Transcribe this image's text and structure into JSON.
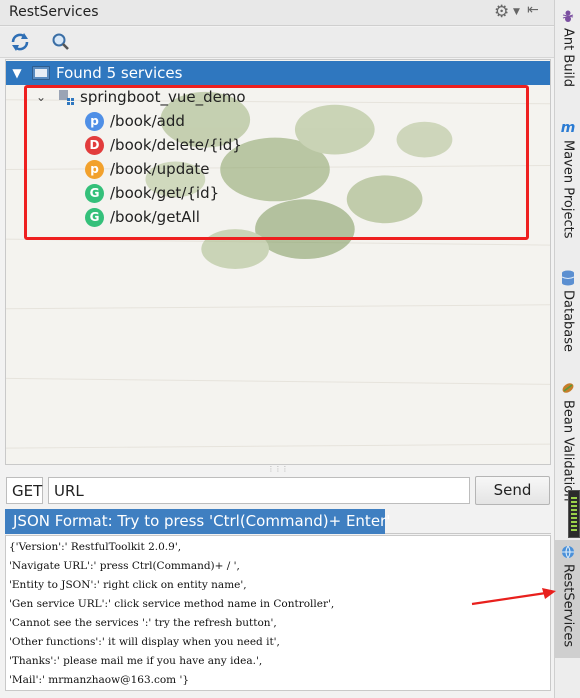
{
  "window": {
    "title": "RestServices"
  },
  "tree": {
    "root_label": "Found 5 services",
    "project": "springboot_vue_demo",
    "services": [
      {
        "badge": "p",
        "kind": "post",
        "path": "/book/add"
      },
      {
        "badge": "D",
        "kind": "delete",
        "path": "/book/delete/{id}"
      },
      {
        "badge": "p",
        "kind": "put",
        "path": "/book/update"
      },
      {
        "badge": "G",
        "kind": "get",
        "path": "/book/get/{id}"
      },
      {
        "badge": "G",
        "kind": "get",
        "path": "/book/getAll"
      }
    ]
  },
  "request": {
    "method": "GET",
    "url_value": "URL",
    "send_label": "Send"
  },
  "format_tab": {
    "label": "JSON Format: Try to press 'Ctrl(Command)+ Enter'"
  },
  "json_lines": [
    "{'Version':' RestfulToolkit 2.0.9',",
    "'Navigate URL':' press Ctrl(Command)+ / ',",
    "'Entity to JSON':' right click on entity name',",
    "'Gen service URL':' click service method name in Controller',",
    "'Cannot see the services ':' try the refresh button',",
    "'Other functions':' it will display when you need it',",
    "'Thanks':' please mail me if you have any idea.',",
    "'Mail':' mrmanzhaow@163.com '}"
  ],
  "sidebar": {
    "tabs": [
      "Ant Build",
      "Maven Projects",
      "Database",
      "Bean Validation",
      "RestServices"
    ],
    "active": "RestServices"
  },
  "colors": {
    "selection": "#2f77bf",
    "highlight_box": "#ee1f1f",
    "post": "#4f8fe6",
    "delete": "#e23c3c",
    "put": "#f2a12c",
    "get": "#34c07a"
  },
  "icons": [
    "settings-icon",
    "pin-icon",
    "refresh-icon",
    "search-icon",
    "folder-icon",
    "project-icon",
    "expand-chevron-icon"
  ]
}
